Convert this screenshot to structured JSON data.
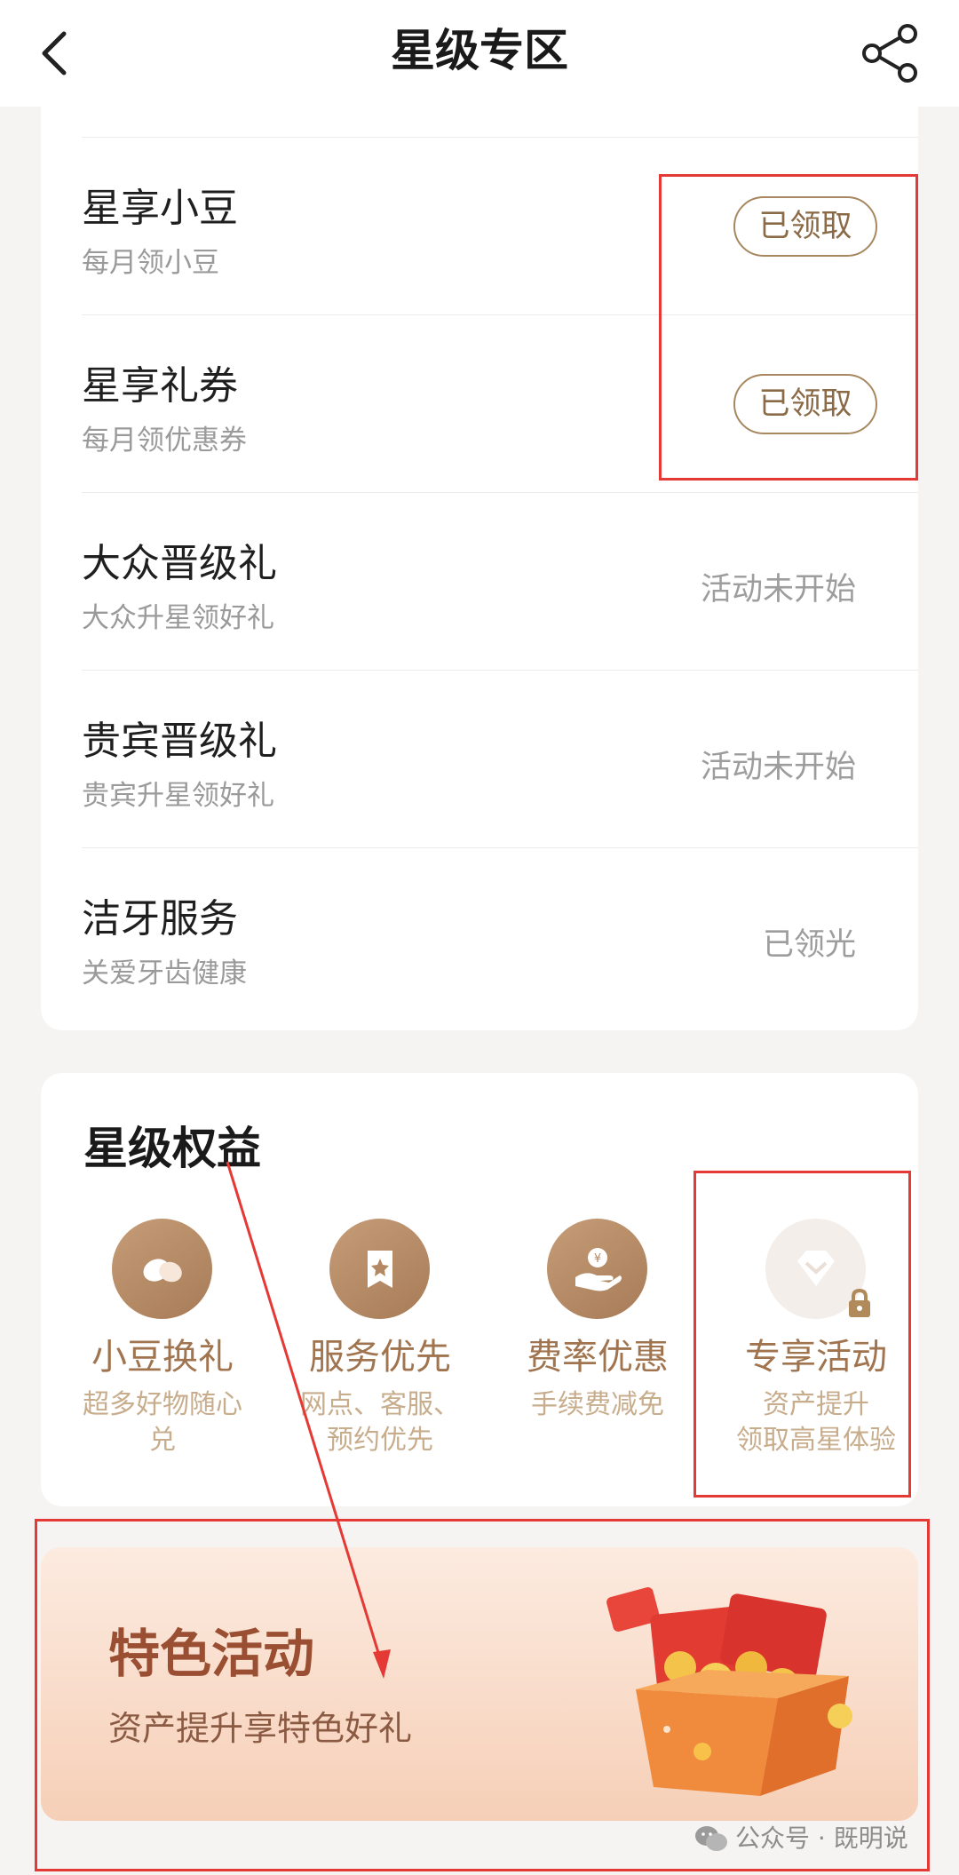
{
  "header": {
    "title": "星级专区"
  },
  "gift_list": [
    {
      "title": "星享小豆",
      "subtitle": "每月领小豆",
      "status": "已领取"
    },
    {
      "title": "星享礼券",
      "subtitle": "每月领优惠券",
      "status": "已领取"
    },
    {
      "title": "大众晋级礼",
      "subtitle": "大众升星领好礼",
      "status": "活动未开始"
    },
    {
      "title": "贵宾晋级礼",
      "subtitle": "贵宾升星领好礼",
      "status": "活动未开始"
    },
    {
      "title": "洁牙服务",
      "subtitle": "关爱牙齿健康",
      "status": "已领光"
    }
  ],
  "benefits": {
    "title": "星级权益",
    "items": [
      {
        "label": "小豆换礼",
        "desc_line1": "超多好物随心",
        "desc_line2": "兑",
        "icon": "beans-icon"
      },
      {
        "label": "服务优先",
        "desc_line1": "网点、客服、",
        "desc_line2": "预约优先",
        "icon": "priority-ticket-icon"
      },
      {
        "label": "费率优惠",
        "desc_line1": "手续费减免",
        "desc_line2": "",
        "icon": "coin-hand-icon"
      },
      {
        "label": "专享活动",
        "desc_line1": "资产提升",
        "desc_line2": "领取高星体验",
        "icon": "diamond-icon",
        "locked": true
      }
    ]
  },
  "banner": {
    "title": "特色活动",
    "subtitle": "资产提升享特色好礼"
  },
  "watermark": {
    "text": "公众号 · 既明说"
  },
  "colors": {
    "accent_brown": "#a0744f",
    "annotation_red": "#e53935",
    "banner_title": "#9a4f33"
  }
}
